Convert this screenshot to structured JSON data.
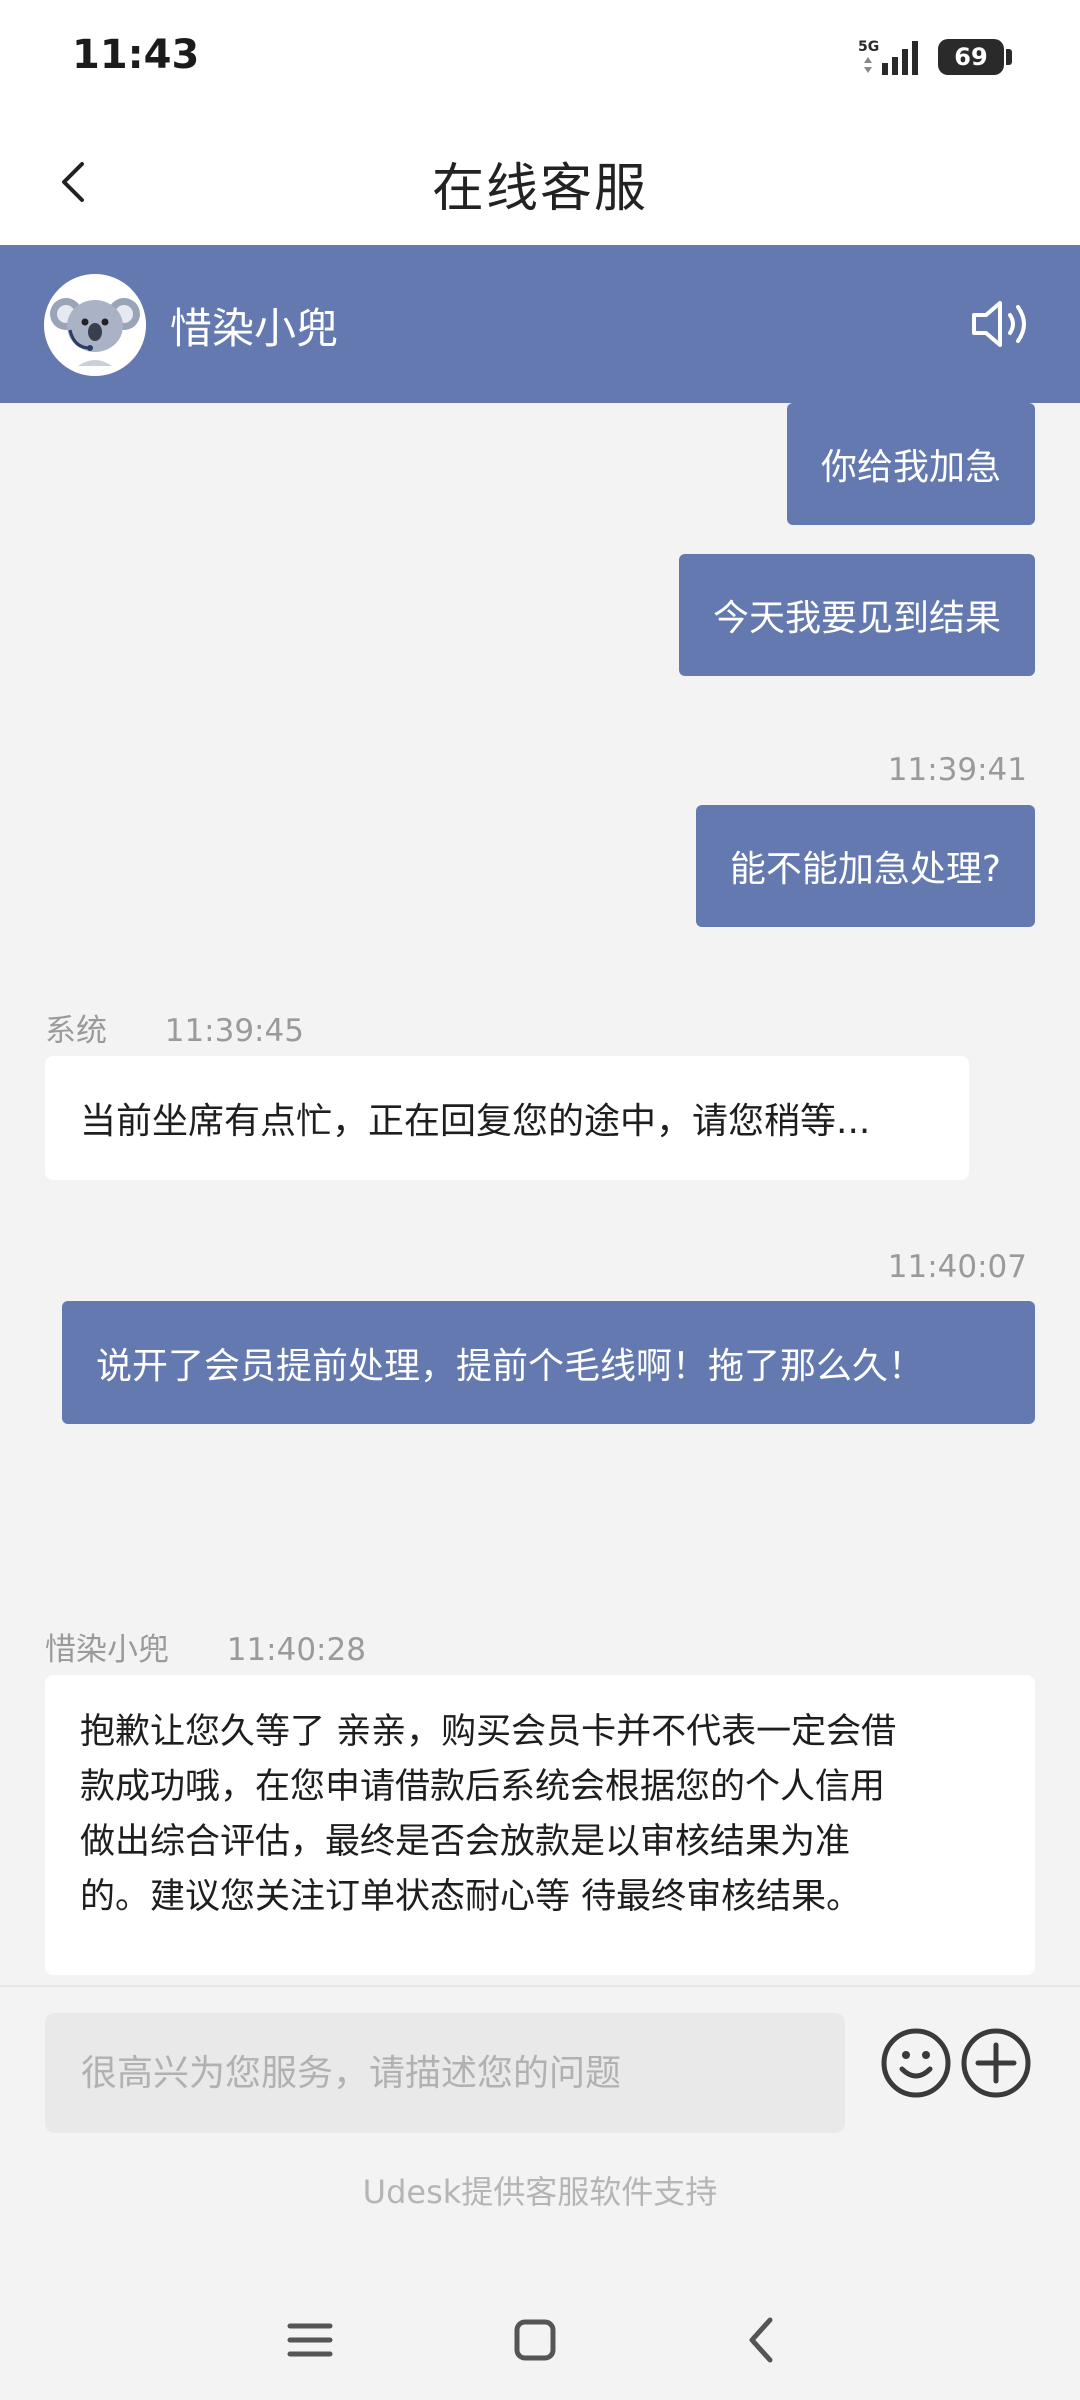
{
  "status_bar": {
    "time": "11:43",
    "network": "5G",
    "battery": "69"
  },
  "nav": {
    "title": "在线客服"
  },
  "agent": {
    "name": "惜染小兜"
  },
  "messages": [
    {
      "side": "right",
      "text": "你给我加急"
    },
    {
      "side": "right",
      "text": "今天我要见到结果"
    },
    {
      "side": "right",
      "time": "11:39:41",
      "text": "能不能加急处理?"
    },
    {
      "side": "left",
      "sender": "系统",
      "time": "11:39:45",
      "text": "当前坐席有点忙，正在回复您的途中，请您稍等..."
    },
    {
      "side": "right",
      "time": "11:40:07",
      "text": "说开了会员提前处理，提前个毛线啊！拖了那么久！"
    },
    {
      "side": "left",
      "sender": "惜染小兜",
      "time": "11:40:28",
      "lines": [
        "抱歉让您久等了 亲亲，购买会员卡并不代表一定会借",
        "款成功哦，在您申请借款后系统会根据您的个人信用",
        "做出综合评估，最终是否会放款是以审核结果为准",
        "的。建议您关注订单状态耐心等 待最终审核结果。"
      ]
    }
  ],
  "input": {
    "placeholder": "很高兴为您服务，请描述您的问题"
  },
  "footer": {
    "powered_by": "Udesk提供客服软件支持"
  },
  "colors": {
    "accent": "#6479b0",
    "background": "#f3f3f3"
  }
}
